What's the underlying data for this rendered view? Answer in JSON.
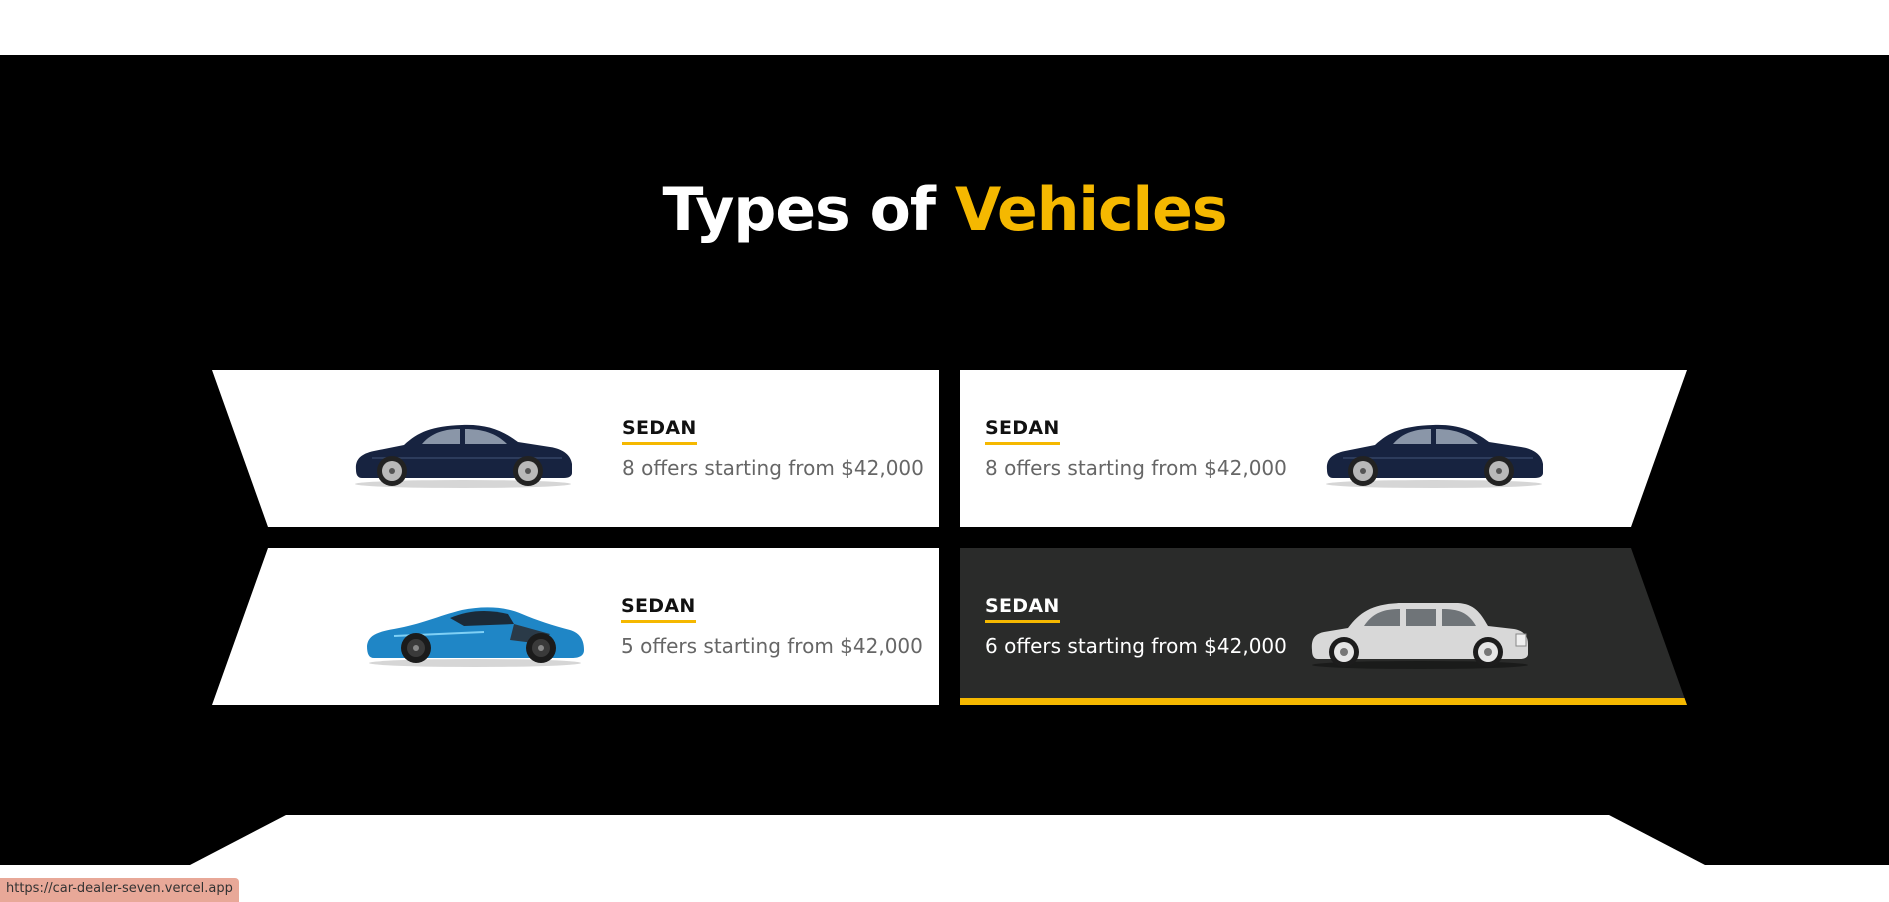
{
  "heading": {
    "part1": "Types of",
    "part2": "Vehicles"
  },
  "colors": {
    "accent": "#f5b800",
    "background": "#000000",
    "highlighted_card": "#2a2b2a"
  },
  "cards": [
    {
      "type": "SEDAN",
      "offers": "8 offers starting from $42,000",
      "image": "dark-blue-sedan-car"
    },
    {
      "type": "SEDAN",
      "offers": "8 offers starting from $42,000",
      "image": "dark-blue-sedan-car"
    },
    {
      "type": "SEDAN",
      "offers": "5 offers starting from $42,000",
      "image": "blue-sports-car"
    },
    {
      "type": "SEDAN",
      "offers": "6 offers starting from $42,000",
      "image": "white-luxury-sedan-car",
      "active": true
    }
  ],
  "status_url": "https://car-dealer-seven.vercel.app"
}
